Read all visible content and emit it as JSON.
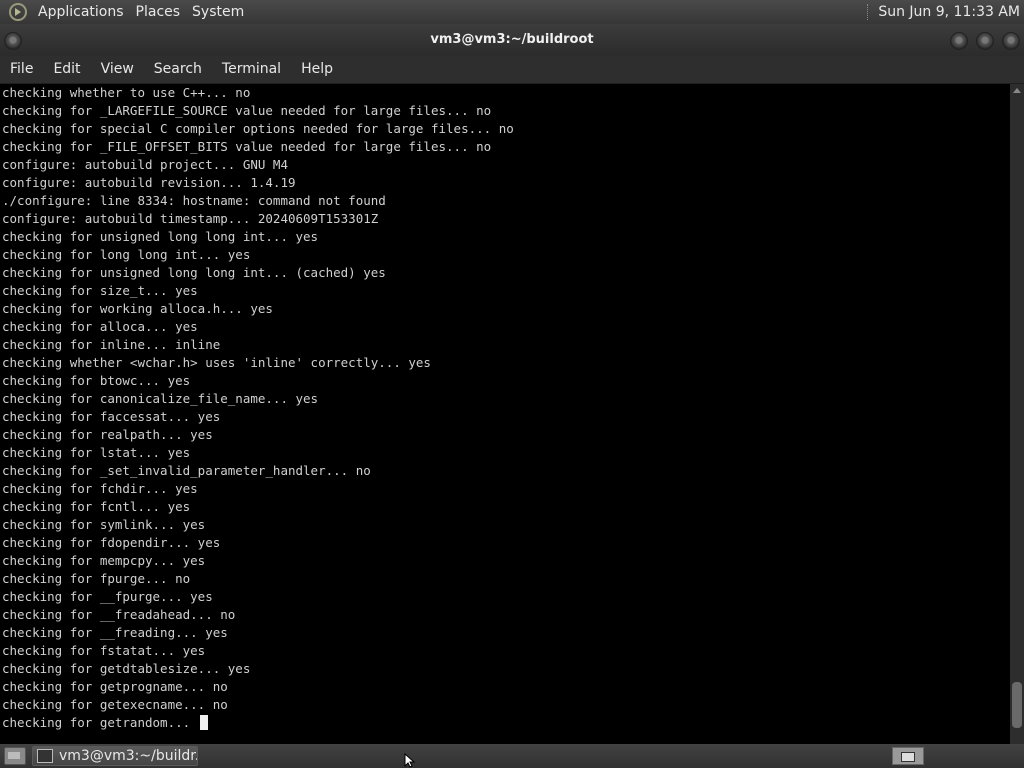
{
  "top_panel": {
    "menus": [
      "Applications",
      "Places",
      "System"
    ],
    "clock": "Sun Jun  9, 11:33 AM"
  },
  "window": {
    "title": "vm3@vm3:~/buildroot"
  },
  "menubar": [
    "File",
    "Edit",
    "View",
    "Search",
    "Terminal",
    "Help"
  ],
  "terminal": {
    "lines": [
      "checking whether to use C++... no",
      "checking for _LARGEFILE_SOURCE value needed for large files... no",
      "checking for special C compiler options needed for large files... no",
      "checking for _FILE_OFFSET_BITS value needed for large files... no",
      "configure: autobuild project... GNU M4",
      "configure: autobuild revision... 1.4.19",
      "./configure: line 8334: hostname: command not found",
      "configure: autobuild timestamp... 20240609T153301Z",
      "checking for unsigned long long int... yes",
      "checking for long long int... yes",
      "checking for unsigned long long int... (cached) yes",
      "checking for size_t... yes",
      "checking for working alloca.h... yes",
      "checking for alloca... yes",
      "checking for inline... inline",
      "checking whether <wchar.h> uses 'inline' correctly... yes",
      "checking for btowc... yes",
      "checking for canonicalize_file_name... yes",
      "checking for faccessat... yes",
      "checking for realpath... yes",
      "checking for lstat... yes",
      "checking for _set_invalid_parameter_handler... no",
      "checking for fchdir... yes",
      "checking for fcntl... yes",
      "checking for symlink... yes",
      "checking for fdopendir... yes",
      "checking for mempcpy... yes",
      "checking for fpurge... no",
      "checking for __fpurge... yes",
      "checking for __freadahead... no",
      "checking for __freading... yes",
      "checking for fstatat... yes",
      "checking for getdtablesize... yes",
      "checking for getprogname... no",
      "checking for getexecname... no"
    ],
    "current_line": "checking for getrandom... "
  },
  "taskbar": {
    "task_label": "vm3@vm3:~/buildr..."
  }
}
